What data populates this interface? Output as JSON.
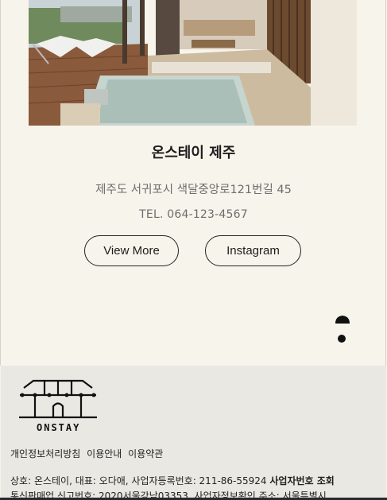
{
  "property": {
    "name": "온스테이 제주",
    "address": "제주도 서귀포시 색달중앙로121번길 45",
    "phone": "TEL. 064-123-4567"
  },
  "buttons": {
    "view_more": "View More",
    "instagram": "Instagram"
  },
  "icons": {
    "scroll_top": "chevron-up-icon",
    "logo": "hanok-gate-logo"
  },
  "footer": {
    "logo_text": "ONSTAY",
    "links": [
      "개인정보처리방침",
      "이용안내",
      "이용약관"
    ],
    "biz_line1_prefix": "상호: 온스테이, 대표: 오다애, 사업자등록번호: 211-86-55924",
    "biz_line1_link": "사업자번호 조회",
    "biz_line2": "통신판매업 신고번호: 2020서울강남03353, 사업자정보확인 주소: 서울특별시"
  },
  "colors": {
    "background": "#f7f4ec",
    "footer_bg": "#e9e8e2",
    "text_muted": "#6d6d6d"
  }
}
